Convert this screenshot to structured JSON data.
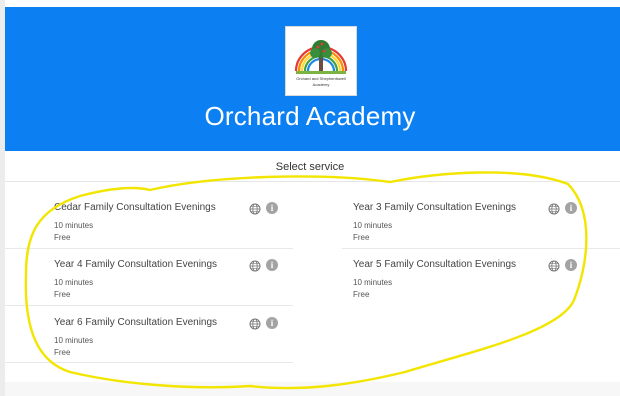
{
  "header": {
    "logo": {
      "name_line1": "Orchard and Shepherdswell",
      "name_line2": "Academy"
    },
    "school_name": "Orchard Academy"
  },
  "section_title": "Select service",
  "services": [
    {
      "title": "Cedar Family Consultation Evenings",
      "duration": "10 minutes",
      "price": "Free"
    },
    {
      "title": "Year 3 Family Consultation Evenings",
      "duration": "10 minutes",
      "price": "Free"
    },
    {
      "title": "Year 4 Family Consultation Evenings",
      "duration": "10 minutes",
      "price": "Free"
    },
    {
      "title": "Year 5 Family Consultation Evenings",
      "duration": "10 minutes",
      "price": "Free"
    },
    {
      "title": "Year 6 Family Consultation Evenings",
      "duration": "10 minutes",
      "price": "Free"
    }
  ],
  "icons": {
    "online": "globe-icon",
    "details": "info-icon"
  },
  "colors": {
    "banner": "#0c80f3",
    "annotation": "#f2e500",
    "info_badge": "#a3a3a3"
  }
}
